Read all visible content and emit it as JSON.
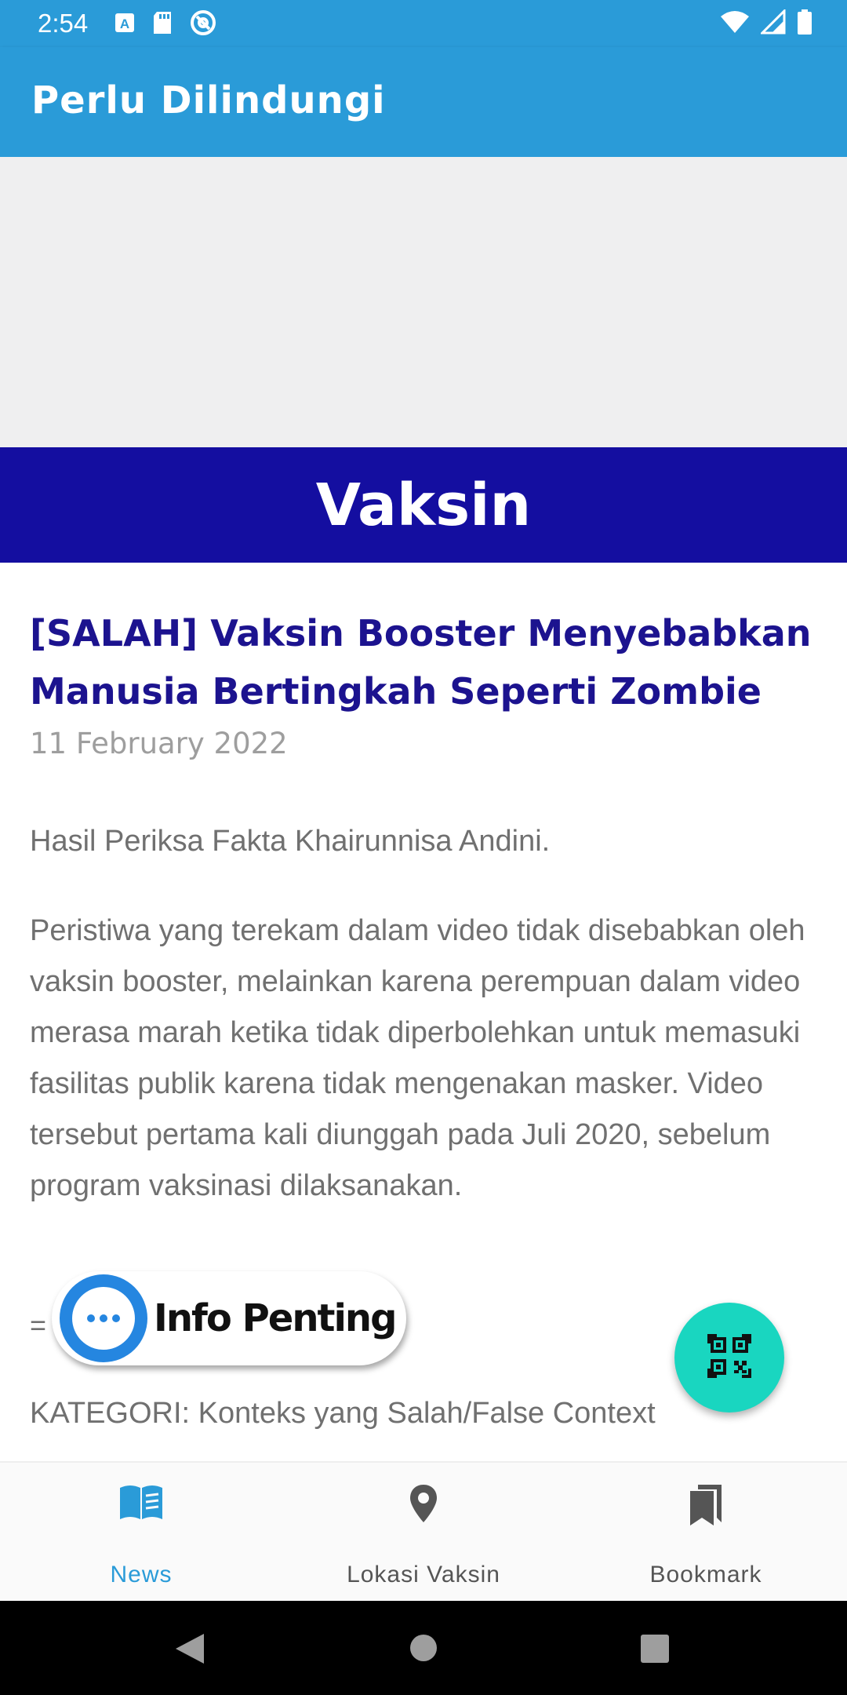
{
  "status_bar": {
    "time": "2:54",
    "left_icons": [
      "font-a-icon",
      "sd-card-icon",
      "at-sign-icon"
    ],
    "right_icons": [
      "wifi-icon",
      "signal-icon",
      "battery-icon"
    ]
  },
  "app_bar": {
    "title": "Perlu Dilindungi"
  },
  "category": {
    "label": "Vaksin"
  },
  "article": {
    "title": "[SALAH] Vaksin Booster Menyebabkan Manusia Bertingkah Seperti Zombie",
    "date": "11 February 2022",
    "paragraphs": [
      "Hasil Periksa Fakta Khairunnisa Andini.",
      "Peristiwa yang terekam dalam video tidak disebabkan oleh vaksin booster, melainkan karena perempuan dalam video merasa marah ketika tidak diperbolehkan untuk memasuki fasilitas publik karena tidak mengenakan masker. Video tersebut pertama kali diunggah pada Juli 2020, sebelum program vaksinasi dilaksanakan."
    ],
    "partial_line": "=",
    "kategori": "KATEGORI: Konteks yang Salah/False Context"
  },
  "info_chip": {
    "label": "Info Penting"
  },
  "fab": {
    "icon": "qr-scan-icon"
  },
  "bottom_nav": {
    "items": [
      {
        "label": "News",
        "icon": "book-icon",
        "active": true
      },
      {
        "label": "Lokasi Vaksin",
        "icon": "location-pin-icon",
        "active": false
      },
      {
        "label": "Bookmark",
        "icon": "bookmark-icon",
        "active": false
      }
    ]
  },
  "colors": {
    "primary": "#2a9bd8",
    "category_banner": "#140ea0",
    "title_text": "#1c138f",
    "fab": "#19d6c0",
    "nav_active": "#2a9bd8",
    "nav_inactive": "#555555"
  }
}
